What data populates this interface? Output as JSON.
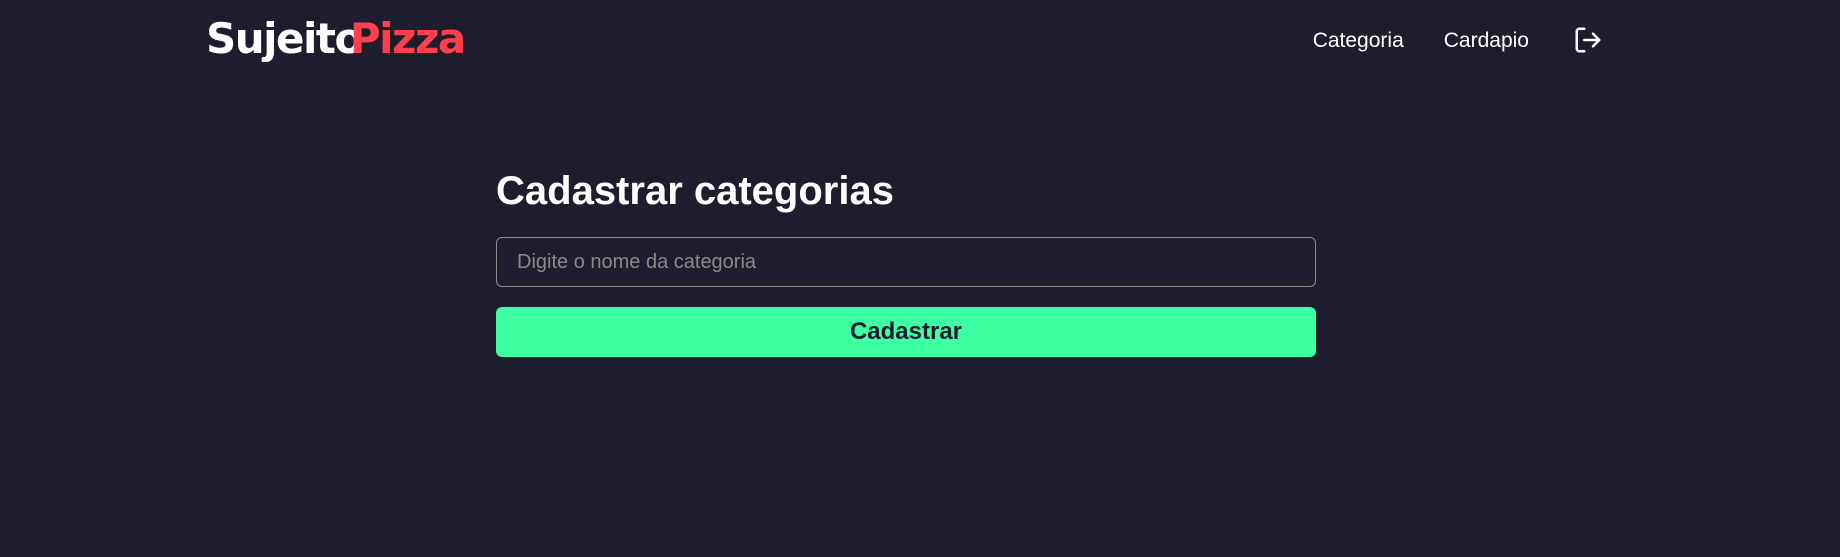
{
  "header": {
    "logo_part_a": "Sujeito",
    "logo_part_b": "Pizza",
    "nav": [
      {
        "label": "Categoria"
      },
      {
        "label": "Cardapio"
      }
    ],
    "logout_icon": "logout-icon"
  },
  "main": {
    "title": "Cadastrar categorias",
    "input_placeholder": "Digite o nome da categoria",
    "input_value": "",
    "submit_label": "Cadastrar"
  },
  "colors": {
    "background": "#1d1d2e",
    "brand_red": "#ff3f4b",
    "accent_green": "#3fffa3",
    "text": "#ffffff",
    "muted": "#8a8a8a"
  }
}
